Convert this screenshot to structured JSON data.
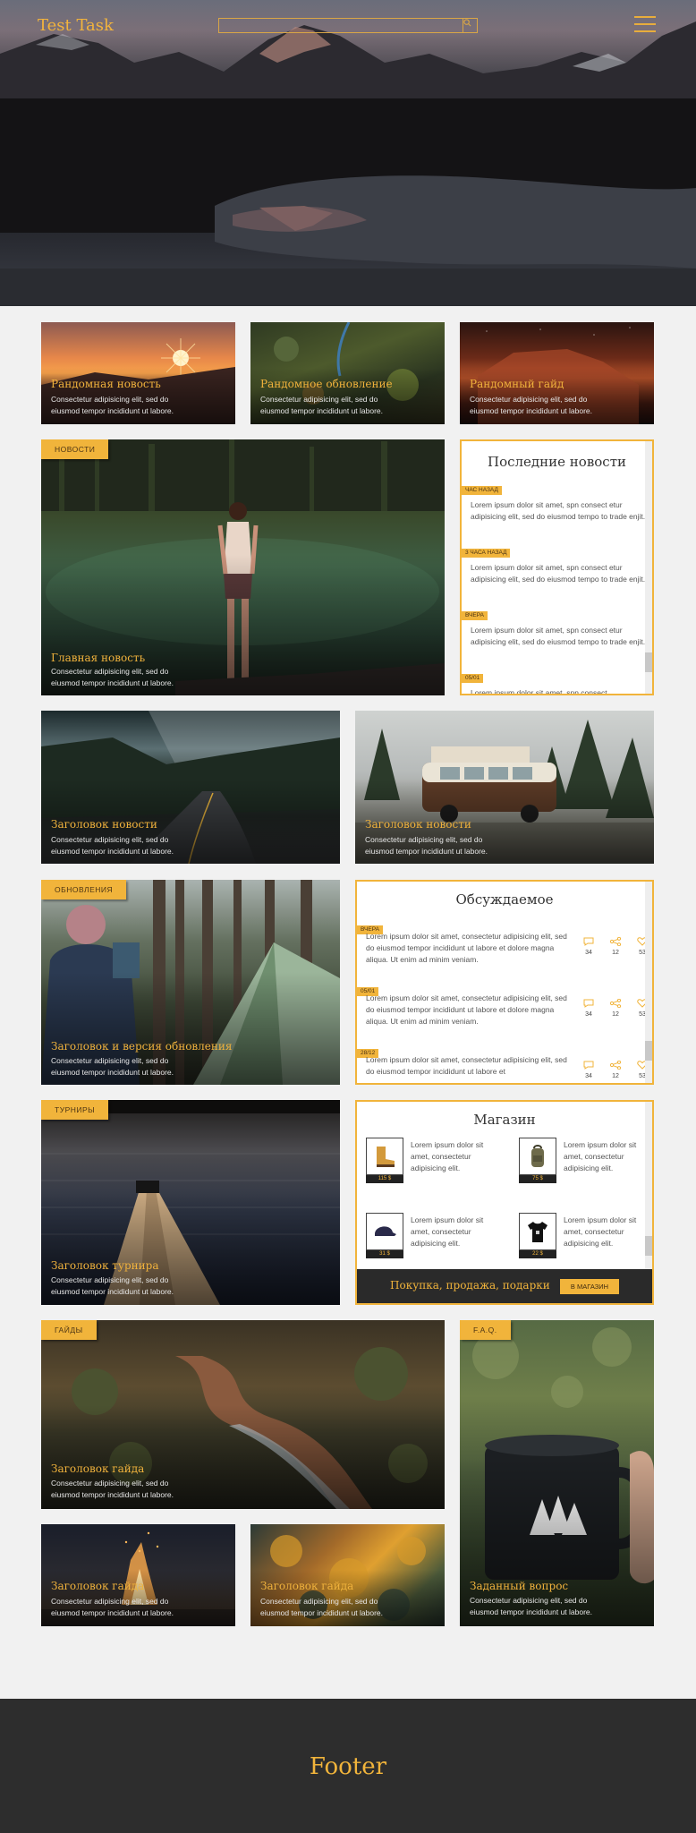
{
  "header": {
    "logo": "Test Task",
    "search_placeholder": ""
  },
  "top_cards": [
    {
      "title": "Рандомная новость",
      "text": "Consectetur adipisicing elit, sed do eiusmod tempor incididunt ut labore."
    },
    {
      "title": "Рандомное обновление",
      "text": "Consectetur adipisicing elit, sed do eiusmod tempor incididunt ut labore."
    },
    {
      "title": "Рандомный гайд",
      "text": "Consectetur adipisicing elit, sed do eiusmod tempor incididunt ut labore."
    }
  ],
  "news_section": {
    "tag": "НОВОСТИ",
    "main": {
      "title": "Главная новость",
      "text": "Consectetur adipisicing elit, sed do eiusmod tempor incididunt ut labore."
    }
  },
  "latest_news": {
    "title": "Последние новости",
    "items": [
      {
        "time": "ЧАС НАЗАД",
        "text": "Lorem ipsum dolor sit amet,  spn consect etur adipisicing elit, sed do eiusmod tempo to trade enjit."
      },
      {
        "time": "3 ЧАСА НАЗАД",
        "text": "Lorem ipsum dolor sit amet,  spn consect etur adipisicing elit, sed do eiusmod tempo to trade enjit."
      },
      {
        "time": "ВЧЕРА",
        "text": "Lorem ipsum dolor sit amet,  spn consect etur adipisicing elit, sed do eiusmod tempo to trade enjit."
      },
      {
        "time": "05/01",
        "text": "Lorem ipsum dolor sit amet,  spn consect"
      }
    ]
  },
  "news_cards": [
    {
      "title": "Заголовок новости",
      "text": "Consectetur adipisicing elit, sed do eiusmod tempor incididunt ut labore."
    },
    {
      "title": "Заголовок новости",
      "text": "Consectetur adipisicing elit, sed do eiusmod tempor incididunt ut labore."
    }
  ],
  "updates": {
    "tag": "ОБНОВЛЕНИЯ",
    "title": "Заголовок и версия обновления",
    "text": "Consectetur adipisicing elit, sed do eiusmod tempor incididunt ut labore."
  },
  "discussed": {
    "title": "Обсуждаемое",
    "items": [
      {
        "time": "ВЧЕРА",
        "text": "Lorem ipsum dolor sit amet, consectetur adipisicing elit, sed do eiusmod tempor incididunt ut labore et dolore magna aliqua. Ut enim ad minim veniam.",
        "comments": "34",
        "shares": "12",
        "likes": "53"
      },
      {
        "time": "05/01",
        "text": "Lorem ipsum dolor sit amet, consectetur adipisicing elit, sed do eiusmod tempor incididunt ut labore et dolore magna aliqua. Ut enim ad minim veniam.",
        "comments": "34",
        "shares": "12",
        "likes": "53"
      },
      {
        "time": "28/12",
        "text": "Lorem ipsum dolor sit amet, consectetur adipisicing elit, sed do eiusmod tempor incididunt ut labore et",
        "comments": "34",
        "shares": "12",
        "likes": "53"
      }
    ]
  },
  "tournaments": {
    "tag": "ТУРНИРЫ",
    "title": "Заголовок турнира",
    "text": "Consectetur adipisicing elit, sed do eiusmod tempor incididunt ut labore."
  },
  "shop": {
    "title": "Магазин",
    "items": [
      {
        "icon": "boot-icon",
        "price": "115 $",
        "text": "Lorem ipsum dolor sit amet, consectetur adipisicing elit."
      },
      {
        "icon": "backpack-icon",
        "price": "75 $",
        "text": "Lorem ipsum dolor sit amet, consectetur adipisicing elit."
      },
      {
        "icon": "cap-icon",
        "price": "31 $",
        "text": "Lorem ipsum dolor sit amet, consectetur adipisicing elit."
      },
      {
        "icon": "tshirt-icon",
        "price": "22 $",
        "text": "Lorem ipsum dolor sit amet, consectetur adipisicing elit."
      }
    ],
    "slogan": "Покупка, продажа, подарки",
    "button": "В МАГАЗИН"
  },
  "guides": {
    "tag": "ГАЙДЫ",
    "main": {
      "title": "Заголовок гайда",
      "text": "Consectetur adipisicing elit, sed do eiusmod tempor incididunt ut labore."
    },
    "small": [
      {
        "title": "Заголовок гайда",
        "text": "Consectetur adipisicing elit, sed do eiusmod tempor incididunt ut labore."
      },
      {
        "title": "Заголовок гайда",
        "text": "Consectetur adipisicing elit, sed do eiusmod tempor incididunt ut labore."
      }
    ]
  },
  "faq": {
    "tag": "F.A.Q.",
    "title": "Заданный вопрос",
    "text": "Consectetur adipisicing elit, sed do eiusmod tempor incididunt ut labore."
  },
  "footer": {
    "title": "Footer"
  }
}
